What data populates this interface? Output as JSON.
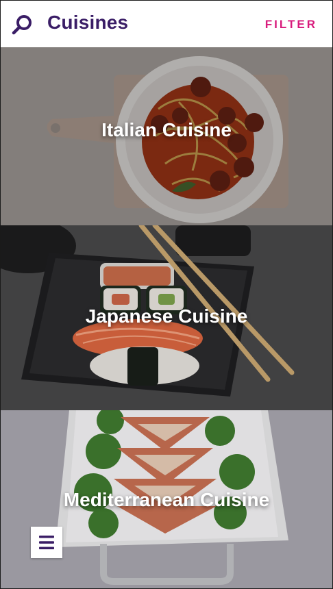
{
  "header": {
    "title": "Cuisines",
    "filter_label": "FILTER",
    "search_icon": "search-icon"
  },
  "cuisines": [
    {
      "label": "Italian Cuisine"
    },
    {
      "label": "Japanese Cuisine"
    },
    {
      "label": "Mediterranean Cuisine"
    }
  ],
  "menu": {
    "icon": "hamburger-menu-icon"
  },
  "colors": {
    "title": "#3a1d66",
    "filter": "#d81b7c",
    "menu_icon": "#3a1d66"
  }
}
